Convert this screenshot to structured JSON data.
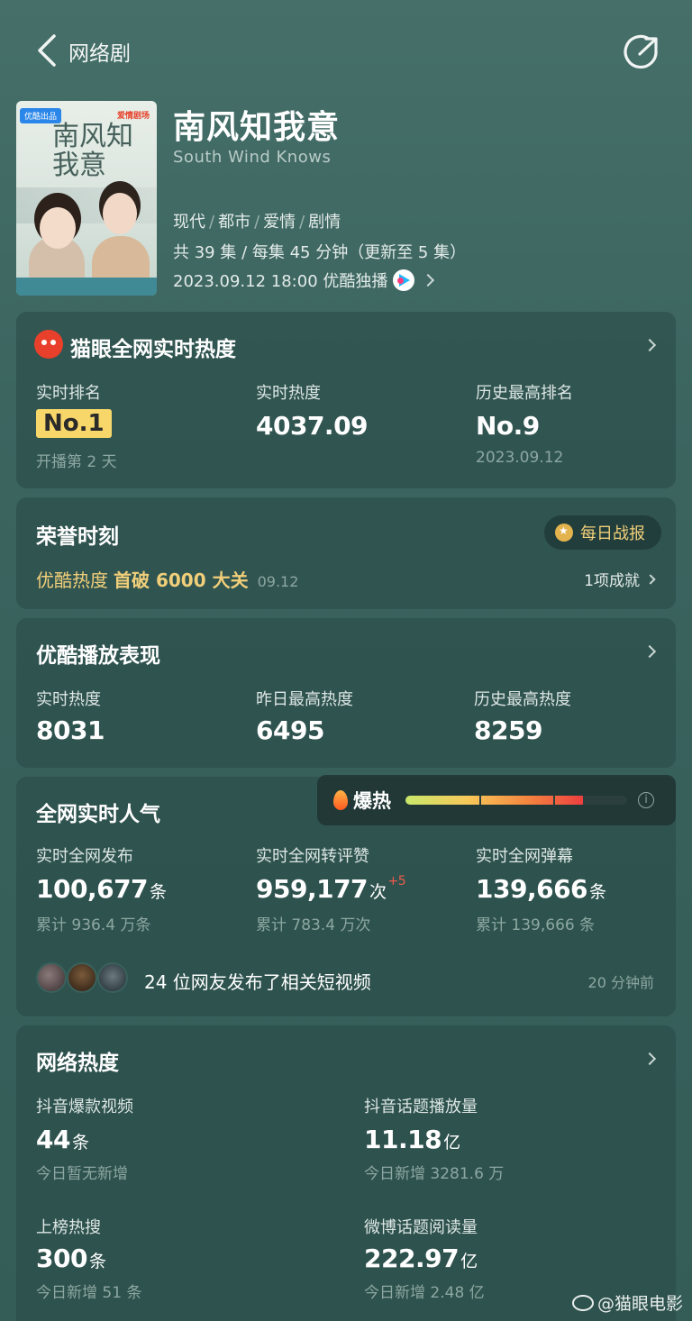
{
  "nav": {
    "title": "网络剧"
  },
  "show": {
    "poster_title": "南风知我意",
    "poster_badge_left": "优酷出品",
    "poster_badge_right": "爱情剧场",
    "title": "南风知我意",
    "en_title": "South Wind Knows",
    "tags": [
      "现代",
      "都市",
      "爱情",
      "剧情"
    ],
    "episodes": "共 39 集 / 每集 45 分钟（更新至 5 集）",
    "release": "2023.09.12 18:00 优酷独播"
  },
  "maoyan": {
    "title": "猫眼全网实时热度",
    "rank_label": "实时排名",
    "rank_value": "No.1",
    "rank_sub": "开播第 2 天",
    "heat_label": "实时热度",
    "heat_value": "4037.09",
    "best_label": "历史最高排名",
    "best_value": "No.9",
    "best_sub": "2023.09.12"
  },
  "honor": {
    "title": "荣誉时刻",
    "daily_label": "每日战报",
    "line_prefix": "优酷热度",
    "line_bold": "首破 6000 大关",
    "line_date": "09.12",
    "achievements": "1项成就"
  },
  "youku": {
    "title": "优酷播放表现",
    "items": [
      {
        "label": "实时热度",
        "value": "8031"
      },
      {
        "label": "昨日最高热度",
        "value": "6495"
      },
      {
        "label": "历史最高热度",
        "value": "8259"
      }
    ]
  },
  "popularity": {
    "title": "全网实时人气",
    "hot_label": "爆热",
    "hot_level": 0.8,
    "items": [
      {
        "label": "实时全网发布",
        "value": "100,677",
        "unit": "条",
        "sub": "累计 936.4 万条"
      },
      {
        "label": "实时全网转评赞",
        "value": "959,177",
        "unit": "次",
        "delta": "+5",
        "sub": "累计 783.4 万次"
      },
      {
        "label": "实时全网弹幕",
        "value": "139,666",
        "unit": "条",
        "sub": "累计 139,666 条"
      }
    ],
    "video_text": "24 位网友发布了相关短视频",
    "video_time": "20 分钟前"
  },
  "network": {
    "title": "网络热度",
    "items": [
      {
        "label": "抖音爆款视频",
        "value": "44",
        "unit": "条",
        "sub": "今日暂无新增"
      },
      {
        "label": "抖音话题播放量",
        "value": "11.18",
        "unit": "亿",
        "sub": "今日新增 3281.6 万"
      },
      {
        "label": "上榜热搜",
        "value": "300",
        "unit": "条",
        "sub": "今日新增 51 条"
      },
      {
        "label": "微博话题阅读量",
        "value": "222.97",
        "unit": "亿",
        "sub": "今日新增 2.48 亿"
      }
    ]
  },
  "watermark": "@猫眼电影"
}
